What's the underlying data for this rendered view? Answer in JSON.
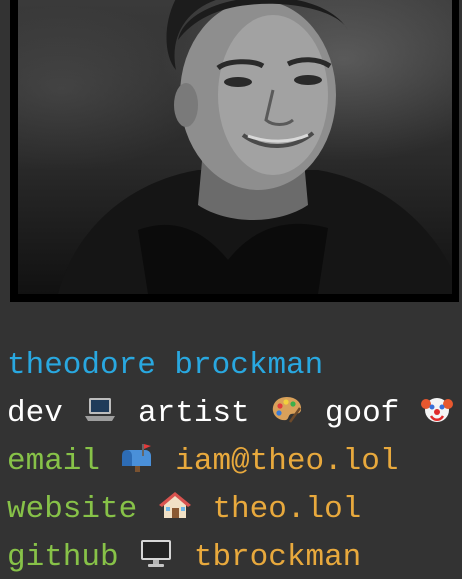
{
  "profile": {
    "name": "theodore brockman",
    "roles": {
      "dev": "dev",
      "artist": "artist",
      "goof": "goof"
    },
    "links": {
      "email_label": "email",
      "email_value": "iam@theo.lol",
      "website_label": "website",
      "website_value": "theo.lol",
      "github_label": "github",
      "github_value": "tbrockman"
    }
  },
  "icons": {
    "dev": "laptop-icon",
    "artist": "palette-icon",
    "goof": "clown-face-icon",
    "email": "mailbox-icon",
    "website": "house-icon",
    "github": "desktop-computer-icon"
  },
  "colors": {
    "background": "#333333",
    "name": "#29a8e0",
    "text": "#ffffff",
    "label": "#87c248",
    "value": "#e8a93d"
  }
}
